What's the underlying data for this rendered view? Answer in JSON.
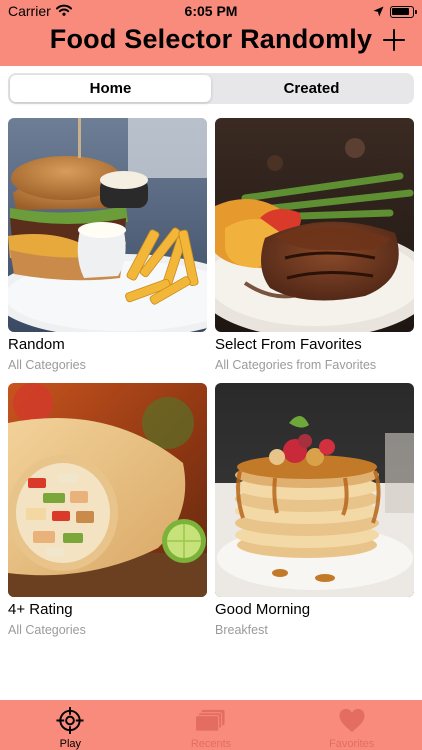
{
  "status_bar": {
    "carrier": "Carrier",
    "time": "6:05 PM"
  },
  "nav": {
    "title": "Food Selector Randomly",
    "add_icon": "plus-icon"
  },
  "segments": [
    {
      "label": "Home",
      "active": true
    },
    {
      "label": "Created",
      "active": false
    }
  ],
  "cards": [
    {
      "title": "Random",
      "subtitle": "All Categories",
      "image": "burger-and-fries-photo"
    },
    {
      "title": "Select From Favorites",
      "subtitle": "All Categories from Favorites",
      "image": "steak-and-asparagus-photo"
    },
    {
      "title": "4+ Rating",
      "subtitle": "All Categories",
      "image": "burrito-photo"
    },
    {
      "title": "Good Morning",
      "subtitle": "Breakfest",
      "image": "pancake-stack-photo"
    }
  ],
  "tabs": [
    {
      "label": "Play",
      "icon": "crosshair-icon",
      "active": true
    },
    {
      "label": "Recents",
      "icon": "stack-icon",
      "active": false
    },
    {
      "label": "Favorites",
      "icon": "heart-icon",
      "active": false
    }
  ],
  "colors": {
    "accent": "#f98b7d",
    "inactive_tab": "#e36d61",
    "subtitle": "#9b9b9b"
  }
}
